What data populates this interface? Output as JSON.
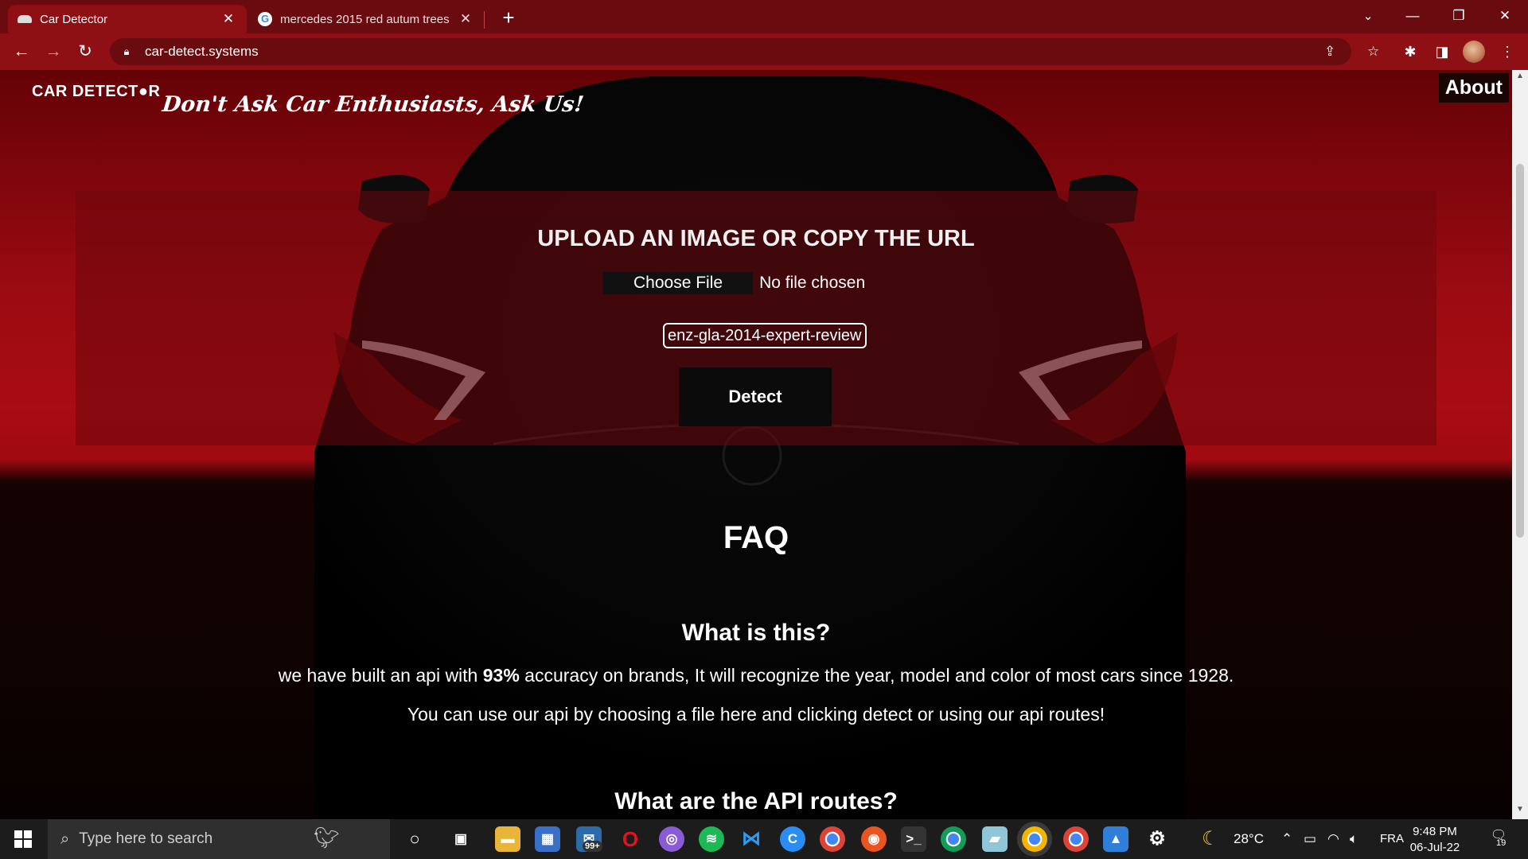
{
  "browser": {
    "tabs": [
      {
        "title": "Car Detector",
        "active": true,
        "icon": "car-favicon"
      },
      {
        "title": "mercedes 2015 red autum trees",
        "active": false,
        "icon": "google-favicon"
      }
    ],
    "new_tab": "+",
    "url": "car-detect.systems",
    "window_controls": [
      "minimize",
      "maximize",
      "close"
    ]
  },
  "site": {
    "logo": "CAR DETECT●R",
    "tagline": "Don't Ask Car Enthusiasts, Ask Us!",
    "about": "About"
  },
  "upload": {
    "heading": "UPLOAD AN IMAGE OR COPY THE URL",
    "choose_file": "Choose File",
    "file_status": "No file chosen",
    "url_value": "enz-gla-2014-expert-review",
    "detect": "Detect"
  },
  "faq": {
    "title": "FAQ",
    "q1": "What is this?",
    "a1_before": "we have built an api with ",
    "a1_bold": "93%",
    "a1_after": " accuracy on brands, It will recognize the year, model and color of most cars since 1928.",
    "a2": "You can use our api by choosing a file here and clicking detect or using our api routes!",
    "q2": "What are the API routes?"
  },
  "taskbar": {
    "search_placeholder": "Type here to search",
    "mail_badge": "99+",
    "weather": "28°C",
    "language": "FRA",
    "time": "9:48 PM",
    "date": "06-Jul-22",
    "notifications": "19"
  },
  "colors": {
    "chrome_dark": "#6a0c0f",
    "chrome_toolbar": "#8e0f14",
    "hero_red": "#a90c13",
    "taskbar": "#1c1c1c"
  }
}
